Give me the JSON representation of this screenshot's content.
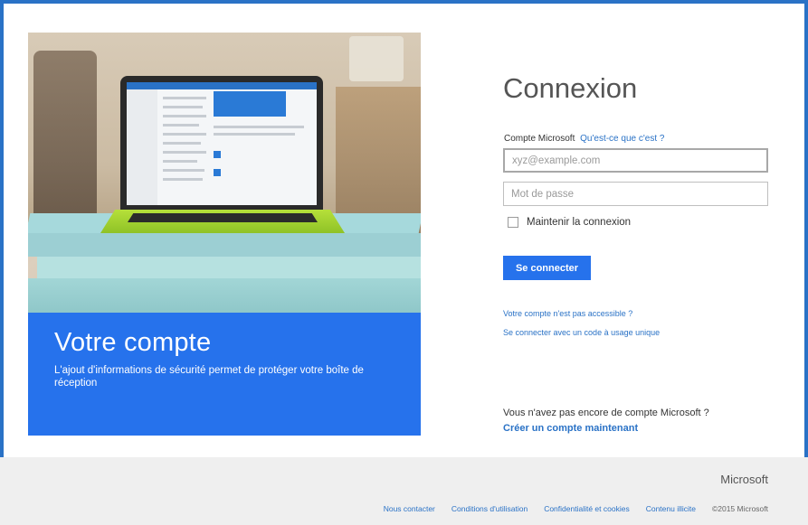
{
  "hero": {
    "title": "Votre compte",
    "text": "L'ajout d'informations de sécurité permet de protéger votre boîte de réception"
  },
  "login": {
    "title": "Connexion",
    "account_label": "Compte Microsoft",
    "account_help_link": "Qu'est-ce que c'est ?",
    "email_placeholder": "xyz@example.com",
    "password_placeholder": "Mot de passe",
    "remember_label": "Maintenir la connexion",
    "remember_checked": false,
    "submit_label": "Se connecter",
    "link_inaccessible": "Votre compte n'est pas accessible ?",
    "link_single_use": "Se connecter avec un code à usage unique",
    "no_account_text": "Vous n'avez pas encore de compte Microsoft ?",
    "create_account_link": "Créer un compte maintenant"
  },
  "footer": {
    "brand": "Microsoft",
    "links": [
      "Nous contacter",
      "Conditions d'utilisation",
      "Confidentialité et cookies",
      "Contenu illicite"
    ],
    "copyright": "©2015 Microsoft"
  },
  "colors": {
    "accent": "#2672ec",
    "frame": "#2a72c6",
    "footer_bg": "#efefef"
  }
}
